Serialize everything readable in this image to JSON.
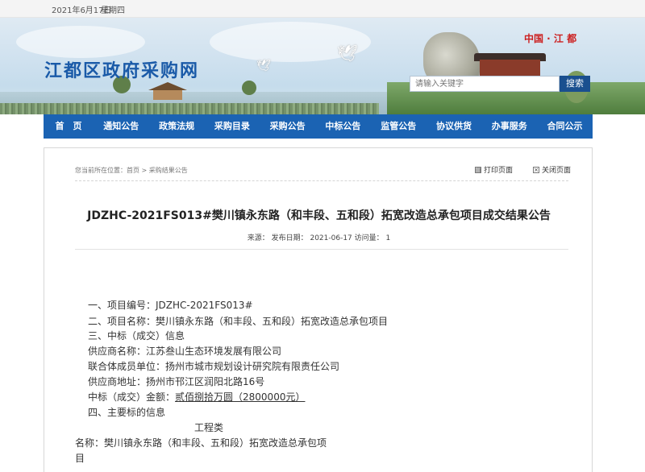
{
  "topbar": {
    "date": "2021年6月17日",
    "weekday": "星期四"
  },
  "header": {
    "site_title": "江都区政府采购网",
    "brand": "中国 · 江 都",
    "search_placeholder": "请输入关键字",
    "search_button": "搜索"
  },
  "nav": {
    "items": [
      "首　页",
      "通知公告",
      "政策法规",
      "采购目录",
      "采购公告",
      "中标公告",
      "监管公告",
      "协议供货",
      "办事服务",
      "合同公示"
    ]
  },
  "breadcrumb": "您当前所在位置：首页 > 采购结果公告",
  "tools": {
    "print": "打印页面",
    "close": "关闭页面"
  },
  "article": {
    "title": "JDZHC-2021FS013#樊川镇永东路（和丰段、五和段）拓宽改造总承包项目成交结果公告",
    "meta": "来源：  发布日期：  2021-06-17  访问量：  1",
    "lines": [
      "一、项目编号：JDZHC-2021FS013#",
      "二、项目名称：樊川镇永东路（和丰段、五和段）拓宽改造总承包项目",
      "三、中标（成交）信息",
      "供应商名称：江苏叁山生态环境发展有限公司",
      "联合体成员单位：扬州市城市规划设计研究院有限责任公司",
      "供应商地址：扬州市邗江区润阳北路16号",
      "中标（成交）金额：",
      "贰佰捌拾万圆（2800000元）",
      "四、主要标的信息",
      "工程类",
      "名称：樊川镇永东路（和丰段、五和段）拓宽改造总承包项",
      "目"
    ]
  },
  "colors": {
    "nav_bg": "#1b63b3",
    "title_blue": "#1a5aa8",
    "brand_red": "#cc1f1f"
  }
}
